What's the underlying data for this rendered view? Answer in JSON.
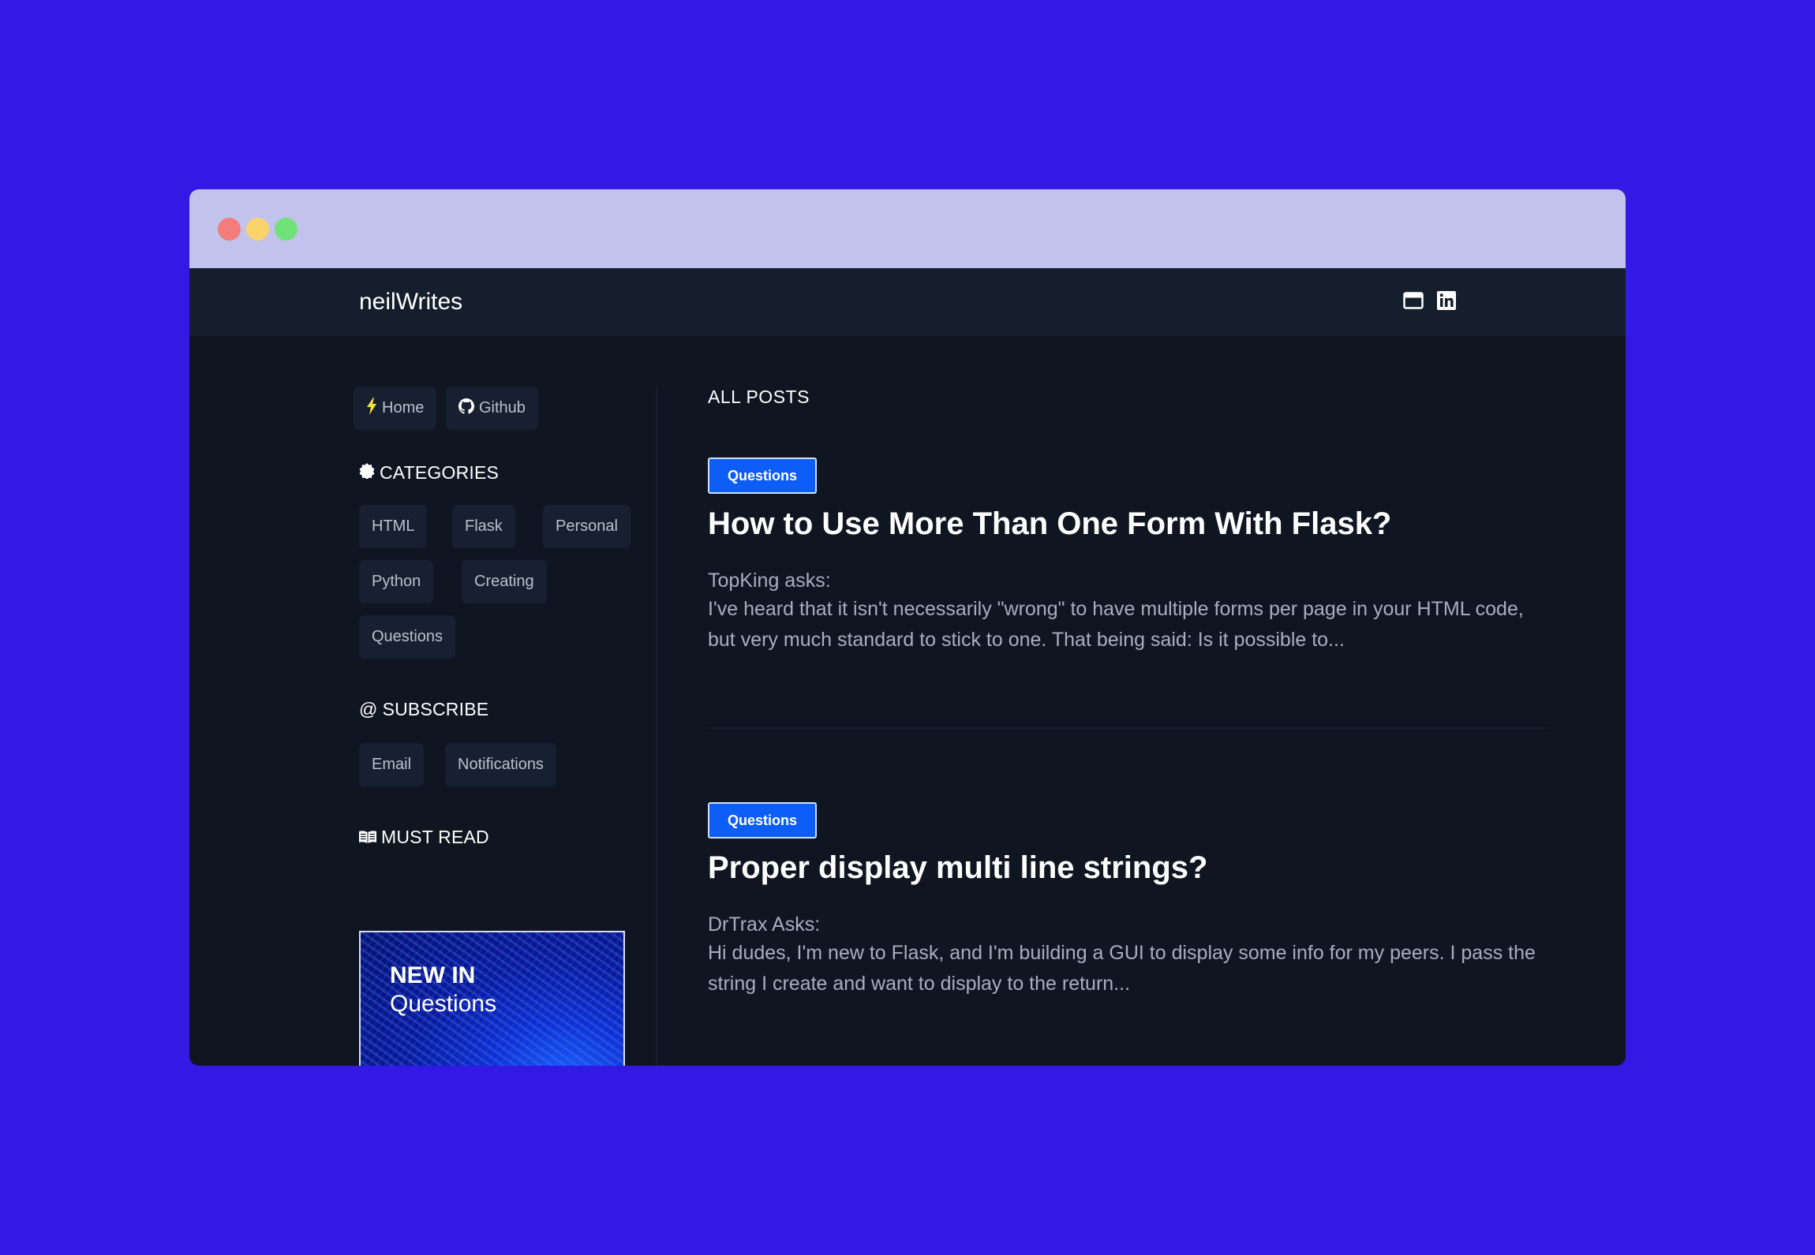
{
  "window": {
    "controls": [
      "close",
      "minimize",
      "maximize"
    ]
  },
  "navbar": {
    "brand": "neilWrites",
    "icons": [
      "browser-window-icon",
      "linkedin-icon"
    ]
  },
  "sidebar": {
    "links": [
      {
        "label": "Home",
        "icon": "lightning-icon"
      },
      {
        "label": "Github",
        "icon": "github-icon"
      }
    ],
    "categories": {
      "title": "CATEGORIES",
      "items": [
        "HTML",
        "Flask",
        "Personal",
        "Python",
        "Creating",
        "Questions"
      ]
    },
    "subscribe": {
      "title": "SUBSCRIBE",
      "prefix": "@",
      "items": [
        "Email",
        "Notifications"
      ]
    },
    "must_read": {
      "title": "MUST READ",
      "card_line1": "NEW IN",
      "card_line2": "Questions"
    }
  },
  "main": {
    "heading": "ALL POSTS",
    "posts": [
      {
        "tag": "Questions",
        "title": "How to Use More Than One Form With Flask?",
        "author": "TopKing asks:",
        "excerpt": "I've heard that it isn't necessarily \"wrong\" to have multiple forms per page in your HTML code, but very much standard to stick to one. That being said: Is it possible to..."
      },
      {
        "tag": "Questions",
        "title": "Proper display multi line strings?",
        "author": "DrTrax Asks:",
        "excerpt": "Hi dudes, I'm new to Flask, and I'm building a GUI to display some info for my peers. I pass the string I create and want to display to the return..."
      }
    ]
  },
  "colors": {
    "background": "#3319e4",
    "titlebar": "#c2c3ec",
    "navbar": "#151e2c",
    "page": "#0f1521",
    "chip": "#172030",
    "tag": "#0d5df7"
  }
}
